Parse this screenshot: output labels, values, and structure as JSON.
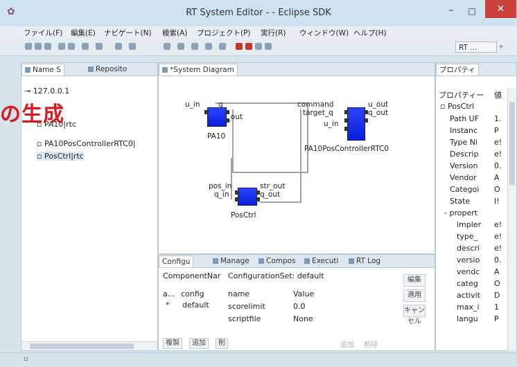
{
  "window": {
    "title": "RT System Editor -  - Eclipse SDK",
    "minimize": "–",
    "maximize": "□",
    "close": "✕"
  },
  "menu": [
    "ファイル(F)",
    "編集(E)",
    "ナビゲート(N)",
    "検索(A)",
    "プロジェクト(P)",
    "実行(R)",
    "ウィンドウ(W)",
    "ヘルプ(H)"
  ],
  "toolbar": {
    "perspective": "RT ...",
    "perspective_more": "»"
  },
  "left_panel": {
    "tabs": [
      "Name S",
      "Reposito"
    ],
    "tree": [
      "127.0.0.1",
      "PA10|rtc",
      "PA10PosControllerRTC0|",
      "PosCtrl|rtc"
    ]
  },
  "overlay_text": "の生成",
  "diagram": {
    "tab": "*System Diagram",
    "components": [
      {
        "name": "PA10",
        "in": "u_in",
        "out_label": "q",
        "out": "u_out"
      },
      {
        "name": "PA10PosControllerRTC0",
        "in1": "command",
        "in2": "target_q",
        "in3": "u_in",
        "out1": "u_out",
        "out2": "q_out"
      },
      {
        "name": "PosCtrl",
        "in1": "pos_in",
        "in2": "q_in",
        "out1": "str_out",
        "out2": "q_out"
      }
    ]
  },
  "bottom": {
    "tabs": [
      "Configu",
      "Manage",
      "Compos",
      "Executi",
      "RT Log"
    ],
    "header_component": "ComponentNar",
    "header_config": "ConfigurationSet: default",
    "left_header": "a...",
    "left_col": "config",
    "left_default_mark": "*",
    "left_default": "default",
    "col_name": "name",
    "col_value": "Value",
    "rows": [
      {
        "name": "scorelimit",
        "value": "0.0"
      },
      {
        "name": "scriptfile",
        "value": "None"
      }
    ],
    "side_buttons": [
      "編集",
      "適用",
      "キャンセル"
    ],
    "bottom_buttons": [
      "複製",
      "追加",
      "削"
    ],
    "disabled_buttons": [
      "追加",
      "削除"
    ]
  },
  "right_panel": {
    "tab": "プロパティ",
    "header": "プロパティー",
    "header_value": "値",
    "root": "PosCtrl",
    "props": [
      {
        "k": "Path UF",
        "v": "1."
      },
      {
        "k": "Instanc",
        "v": "P"
      },
      {
        "k": "Type Ni",
        "v": "e!"
      },
      {
        "k": "Descrip",
        "v": "e!"
      },
      {
        "k": "Version",
        "v": "0."
      },
      {
        "k": "Vendor",
        "v": "A"
      },
      {
        "k": "Categoi",
        "v": "O"
      },
      {
        "k": "State",
        "v": "I!"
      }
    ],
    "group": "propert",
    "sub": [
      {
        "k": "impler",
        "v": "e!"
      },
      {
        "k": "type_",
        "v": "e!"
      },
      {
        "k": "descri",
        "v": "e!"
      },
      {
        "k": "versio",
        "v": "0."
      },
      {
        "k": "vendc",
        "v": "A"
      },
      {
        "k": "categ",
        "v": "O"
      },
      {
        "k": "activit",
        "v": "D"
      },
      {
        "k": "max_i",
        "v": "1"
      },
      {
        "k": "langu",
        "v": "P"
      }
    ]
  }
}
